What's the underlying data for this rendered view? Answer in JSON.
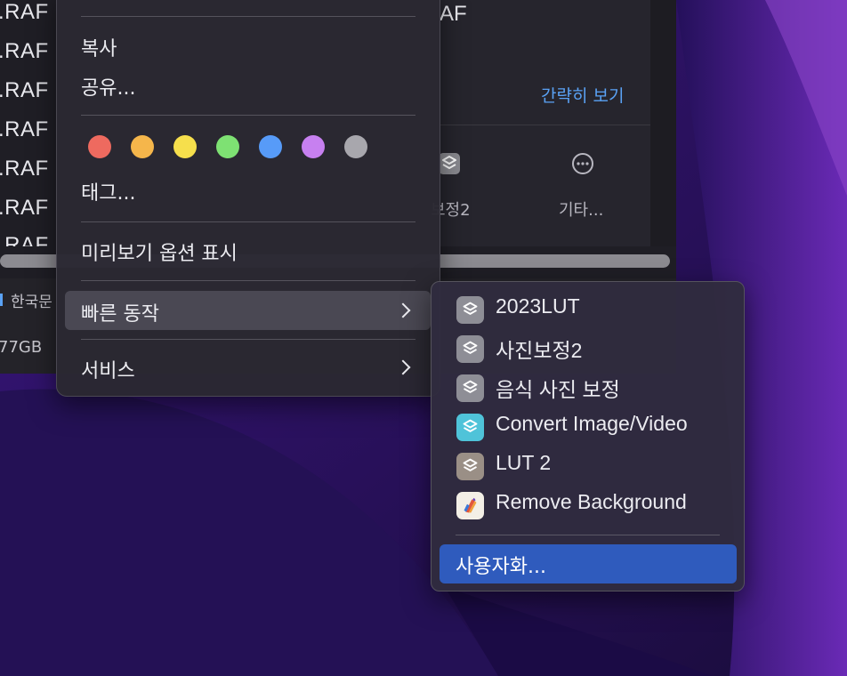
{
  "finder": {
    "files": [
      ".RAF",
      ".RAF",
      ".RAF",
      ".RAF",
      ".RAF",
      ".RAF",
      ".RAF"
    ],
    "preview_title": "AF",
    "show_less": "간략히 보기",
    "quick_action_label": "보정2",
    "more_label": "기타...",
    "status_lang": "한국문",
    "status_disk": "77GB"
  },
  "context_menu": {
    "copy": "복사",
    "share": "공유...",
    "tags_label": "태그...",
    "show_preview_options": "미리보기 옵션 표시",
    "quick_actions": "빠른 동작",
    "services": "서비스",
    "tag_colors": [
      "#ee6a5f",
      "#f5b64b",
      "#f6df4c",
      "#7ee173",
      "#579bf8",
      "#c780f0",
      "#a8a7ad"
    ]
  },
  "submenu": {
    "items": [
      {
        "label": "2023LUT",
        "icon": "shortcuts-icon",
        "color": "#8e8e96"
      },
      {
        "label": "사진보정2",
        "icon": "shortcuts-icon",
        "color": "#8e8e96"
      },
      {
        "label": "음식 사진 보정",
        "icon": "shortcuts-icon",
        "color": "#8e8e96"
      },
      {
        "label": "Convert Image/Video",
        "icon": "shortcuts-icon",
        "color": "#4fc3d9"
      },
      {
        "label": "LUT 2",
        "icon": "shortcuts-icon",
        "color": "#9a8f86"
      },
      {
        "label": "Remove Background",
        "icon": "pixelmator-icon",
        "color": "#f3efe6"
      }
    ],
    "customize": "사용자화..."
  },
  "colors": {
    "accent": "#2f5bbd",
    "link": "#5aa2f5"
  }
}
